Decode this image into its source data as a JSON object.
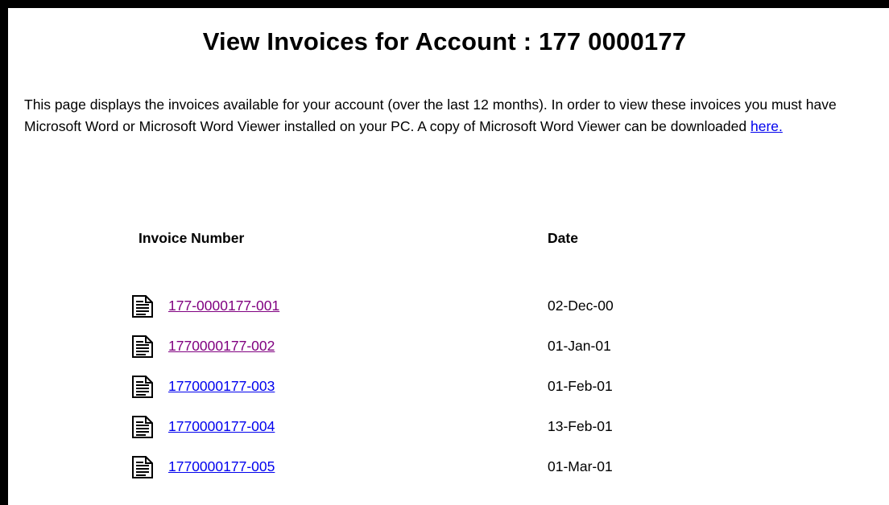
{
  "title": "View Invoices for Account : 177 0000177",
  "intro": {
    "text": "This page displays the invoices available for your account (over the last 12 months). In order to view these invoices you must have Microsoft Word or Microsoft Word Viewer installed on your PC. A copy of Microsoft Word Viewer can be downloaded ",
    "link_label": "here."
  },
  "table": {
    "headers": {
      "invoice": "Invoice Number",
      "date": "Date"
    },
    "rows": [
      {
        "icon": "document-icon",
        "invoice": "177-0000177-001",
        "date": "02-Dec-00",
        "visited": true
      },
      {
        "icon": "document-icon",
        "invoice": "1770000177-002",
        "date": "01-Jan-01",
        "visited": true
      },
      {
        "icon": "document-icon",
        "invoice": "1770000177-003",
        "date": "01-Feb-01",
        "visited": false
      },
      {
        "icon": "document-icon",
        "invoice": "1770000177-004",
        "date": "13-Feb-01",
        "visited": false
      },
      {
        "icon": "document-icon",
        "invoice": "1770000177-005",
        "date": "01-Mar-01",
        "visited": false
      }
    ]
  },
  "colors": {
    "link": "#0000ee",
    "visited_link": "#800080",
    "frame": "#000000"
  }
}
